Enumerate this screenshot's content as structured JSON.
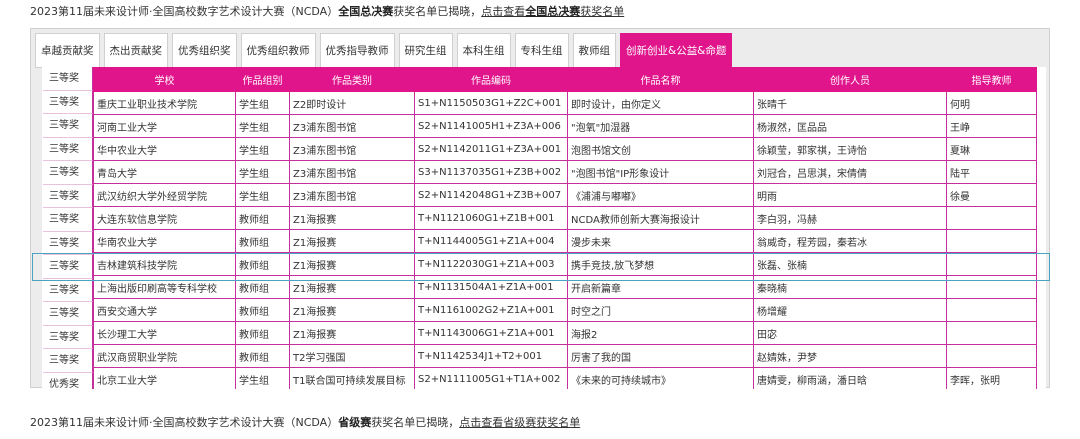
{
  "top_notice": {
    "prefix": "2023第11届未来设计师·全国高校数字艺术设计大赛（NCDA）",
    "bold": "全国总决赛",
    "suffix": "获奖名单已揭晓，",
    "link_text": "点击查看",
    "link_bold": "全国总决赛",
    "link_suffix": "获奖名单"
  },
  "tabs": [
    {
      "label": "卓越贡献奖",
      "active": false
    },
    {
      "label": "杰出贡献奖",
      "active": false
    },
    {
      "label": "优秀组织奖",
      "active": false
    },
    {
      "label": "优秀组织教师",
      "active": false
    },
    {
      "label": "优秀指导教师",
      "active": false
    },
    {
      "label": "研究生组",
      "active": false
    },
    {
      "label": "本科生组",
      "active": false
    },
    {
      "label": "专科生组",
      "active": false
    },
    {
      "label": "教师组",
      "active": false
    },
    {
      "label": "创新创业&公益&命题",
      "active": true
    }
  ],
  "table": {
    "columns": [
      "学校",
      "作品组别",
      "作品类别",
      "作品编码",
      "作品名称",
      "创作人员",
      "指导教师"
    ],
    "awards": [
      "三等奖",
      "三等奖",
      "三等奖",
      "三等奖",
      "三等奖",
      "三等奖",
      "三等奖",
      "三等奖",
      "三等奖",
      "三等奖",
      "三等奖",
      "三等奖",
      "三等奖",
      "优秀奖"
    ],
    "rows": [
      [
        "重庆工业职业技术学院",
        "学生组",
        "Z2即时设计",
        "S1+N1150503G1+Z2C+001",
        "即时设计，由你定义",
        "张晴千",
        "何明"
      ],
      [
        "河南工业大学",
        "学生组",
        "Z3浦东图书馆",
        "S2+N1141005H1+Z3A+006",
        "\"泡氧\"加湿器",
        "杨淑然，匡品品",
        "王峥"
      ],
      [
        "华中农业大学",
        "学生组",
        "Z3浦东图书馆",
        "S2+N1142011G1+Z3A+001",
        "泡图书馆文创",
        "徐颖莹，郭家祺，王诗怡",
        "夏琳"
      ],
      [
        "青岛大学",
        "学生组",
        "Z3浦东图书馆",
        "S3+N1137035G1+Z3B+002",
        "\"泡图书馆\"IP形象设计",
        "刘冠合，吕思淇，宋倩倩",
        "陆平"
      ],
      [
        "武汉纺织大学外经贸学院",
        "学生组",
        "Z3浦东图书馆",
        "S2+N1142048G1+Z3B+007",
        "《浦浦与嘟嘟》",
        "明雨",
        "徐曼"
      ],
      [
        "大连东软信息学院",
        "教师组",
        "Z1海报赛",
        "T+N1121060G1+Z1B+001",
        "NCDA教师创新大赛海报设计",
        "李白羽，冯赫",
        ""
      ],
      [
        "华南农业大学",
        "教师组",
        "Z1海报赛",
        "T+N1144005G1+Z1A+004",
        "漫步未来",
        "翁威奇，程芳园，秦若冰",
        ""
      ],
      [
        "吉林建筑科技学院",
        "教师组",
        "Z1海报赛",
        "T+N1122030G1+Z1A+003",
        "携手竞技,放飞梦想",
        "张磊、张楠",
        ""
      ],
      [
        "上海出版印刷高等专科学校",
        "教师组",
        "Z1海报赛",
        "T+N1131504A1+Z1A+001",
        "开启新篇章",
        "秦晓楠",
        ""
      ],
      [
        "西安交通大学",
        "教师组",
        "Z1海报赛",
        "T+N1161002G2+Z1A+001",
        "时空之门",
        "杨增耀",
        ""
      ],
      [
        "长沙理工大学",
        "教师组",
        "Z1海报赛",
        "T+N1143006G1+Z1A+001",
        "海报2",
        "田宓",
        ""
      ],
      [
        "武汉商贸职业学院",
        "教师组",
        "T2学习强国",
        "T+N1142534J1+T2+001",
        "厉害了我的国",
        "赵婧姝，尹梦",
        ""
      ],
      [
        "北京工业大学",
        "学生组",
        "T1联合国可持续发展目标",
        "S2+N1111005G1+T1A+002",
        "《未来的可持续城市》",
        "唐婧雯，柳雨涵，潘日晗",
        "李晖，张明"
      ]
    ]
  },
  "bottom_notice": {
    "prefix": "2023第11届未来设计师·全国高校数字艺术设计大赛（NCDA）",
    "bold": "省级赛",
    "suffix": "获奖名单已揭晓，",
    "link_text": "点击查看省级赛获奖名单"
  },
  "colors": {
    "accent": "#e0158b",
    "border": "#c42f9b",
    "selection": "#4aa3c2"
  }
}
